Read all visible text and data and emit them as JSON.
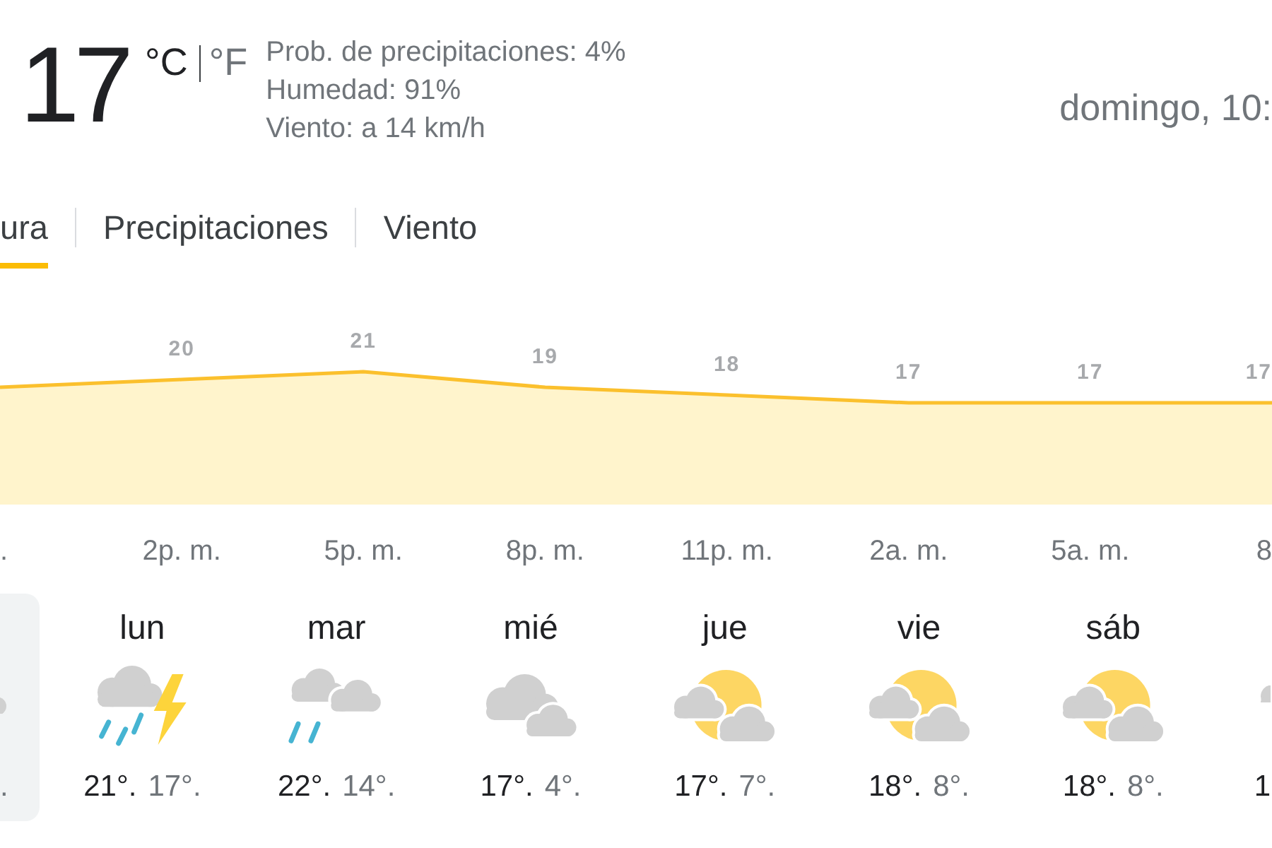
{
  "current": {
    "temperature": "17",
    "units": [
      {
        "label": "°C",
        "selected": true
      },
      {
        "label": "°F",
        "selected": false
      }
    ],
    "details": [
      "Prob. de precipitaciones: 4%",
      "Humedad: 91%",
      "Viento: a 14 km/h"
    ],
    "datetime": "domingo, 10:"
  },
  "tabs": [
    {
      "label": "ura",
      "selected": true
    },
    {
      "label": "Precipitaciones",
      "selected": false
    },
    {
      "label": "Viento",
      "selected": false
    }
  ],
  "hourly": {
    "chart_data": {
      "type": "area",
      "categories": [
        ".",
        "2p. m.",
        "5p. m.",
        "8p. m.",
        "11p. m.",
        "2a. m.",
        "5a. m.",
        "8"
      ],
      "values": [
        19,
        20,
        21,
        19,
        18,
        17,
        17,
        17
      ],
      "value_labels": [
        null,
        "20",
        "21",
        "19",
        "18",
        "17",
        "17",
        "17"
      ]
    }
  },
  "forecast": {
    "days": [
      {
        "kind": "cloud",
        "low": ".",
        "selected": true
      },
      {
        "day": "lun",
        "kind": "storm",
        "high": "21°.",
        "low": "17°.",
        "selected": false
      },
      {
        "day": "mar",
        "kind": "rain",
        "high": "22°.",
        "low": "14°.",
        "selected": false
      },
      {
        "day": "mié",
        "kind": "cloudy",
        "high": "17°.",
        "low": "4°.",
        "selected": false
      },
      {
        "day": "jue",
        "kind": "partly_cloudy",
        "high": "17°.",
        "low": "7°.",
        "selected": false
      },
      {
        "day": "vie",
        "kind": "partly_cloudy",
        "high": "18°.",
        "low": "8°.",
        "selected": false
      },
      {
        "day": "sáb",
        "kind": "partly_cloudy",
        "high": "18°.",
        "low": "8°.",
        "selected": false
      },
      {
        "kind": "cloud",
        "high": "1",
        "selected": false
      }
    ]
  }
}
